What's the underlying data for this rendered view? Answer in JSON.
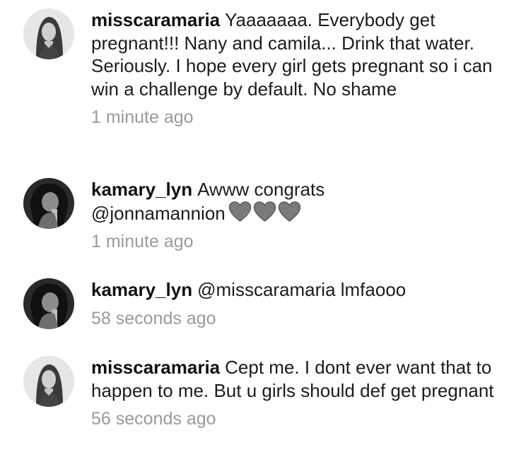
{
  "comments": [
    {
      "username": "misscaramaria",
      "text": "Yaaaaaaa. Everybody get pregnant!!! Nany and camila... Drink that water. Seriously. I hope every girl gets pregnant so i can win a challenge by default. No shame",
      "time": "1 minute ago",
      "avatar": "avatar-woman-light"
    },
    {
      "username": "kamary_lyn",
      "text": "Awww congrats",
      "mention": "@jonnamannion",
      "emoji": [
        "grey-heart",
        "grey-heart",
        "grey-heart"
      ],
      "time": "1 minute ago",
      "avatar": "avatar-woman-dark"
    },
    {
      "username": "kamary_lyn",
      "text": "@misscaramaria lmfaooo",
      "time": "58 seconds ago",
      "avatar": "avatar-woman-dark"
    },
    {
      "username": "misscaramaria",
      "text": "Cept me. I dont ever want that to happen to me. But u girls should def get pregnant",
      "time": "56 seconds ago",
      "avatar": "avatar-woman-light"
    }
  ],
  "colors": {
    "text": "#1c1c1c",
    "timestamp": "#9a9a9a",
    "heart": "#7a7a7a",
    "background": "#ffffff"
  }
}
